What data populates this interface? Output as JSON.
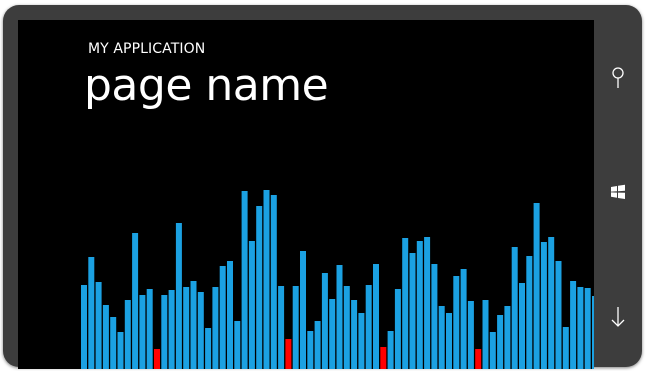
{
  "header": {
    "app_title": "MY APPLICATION",
    "page_title": "page name"
  },
  "hardware_buttons": {
    "search_icon": "search-icon",
    "windows_icon": "windows-logo-icon",
    "back_icon": "back-arrow-icon"
  },
  "colors": {
    "bar_normal": "#1BA1E2",
    "bar_highlight": "#FF0000",
    "screen_background": "#000000",
    "device_frame": "#3D3D3D"
  },
  "chart_data": {
    "type": "bar",
    "ylim": [
      0,
      180
    ],
    "values": [
      84,
      112,
      87,
      64,
      52,
      37,
      69,
      136,
      74,
      80,
      20,
      74,
      79,
      146,
      82,
      88,
      77,
      41,
      82,
      103,
      108,
      48,
      178,
      128,
      163,
      179,
      174,
      83,
      30,
      83,
      118,
      38,
      48,
      96,
      70,
      104,
      83,
      69,
      56,
      84,
      105,
      22,
      38,
      80,
      131,
      116,
      128,
      132,
      105,
      63,
      56,
      93,
      100,
      68,
      20,
      69,
      37,
      54,
      63,
      122,
      86,
      113,
      166,
      127,
      132,
      108,
      42,
      88,
      82,
      81,
      73
    ],
    "highlighted_indices": [
      10,
      28,
      41,
      54
    ]
  }
}
